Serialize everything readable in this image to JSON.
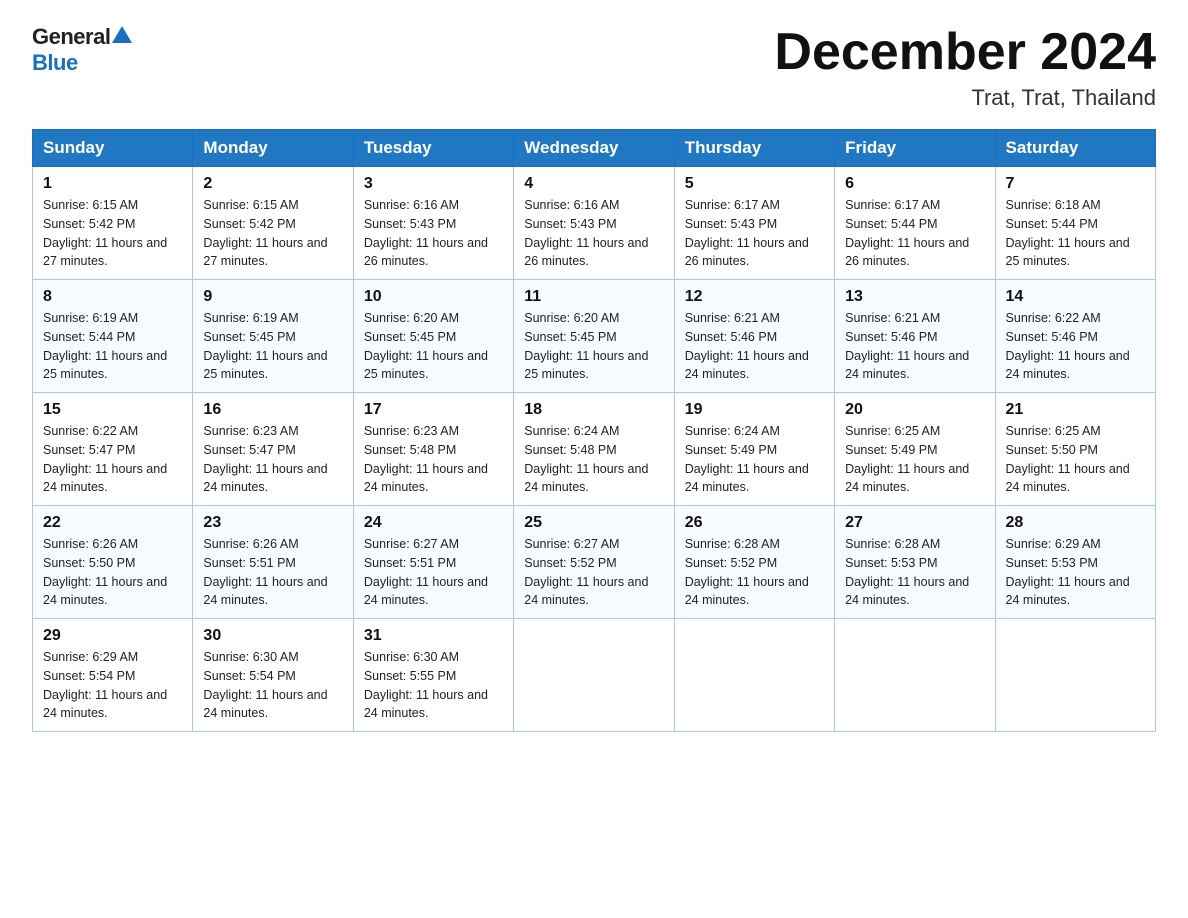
{
  "header": {
    "logo_general": "General",
    "logo_blue": "Blue",
    "month_title": "December 2024",
    "location": "Trat, Trat, Thailand"
  },
  "weekdays": [
    "Sunday",
    "Monday",
    "Tuesday",
    "Wednesday",
    "Thursday",
    "Friday",
    "Saturday"
  ],
  "weeks": [
    [
      {
        "day": "1",
        "sunrise": "Sunrise: 6:15 AM",
        "sunset": "Sunset: 5:42 PM",
        "daylight": "Daylight: 11 hours and 27 minutes."
      },
      {
        "day": "2",
        "sunrise": "Sunrise: 6:15 AM",
        "sunset": "Sunset: 5:42 PM",
        "daylight": "Daylight: 11 hours and 27 minutes."
      },
      {
        "day": "3",
        "sunrise": "Sunrise: 6:16 AM",
        "sunset": "Sunset: 5:43 PM",
        "daylight": "Daylight: 11 hours and 26 minutes."
      },
      {
        "day": "4",
        "sunrise": "Sunrise: 6:16 AM",
        "sunset": "Sunset: 5:43 PM",
        "daylight": "Daylight: 11 hours and 26 minutes."
      },
      {
        "day": "5",
        "sunrise": "Sunrise: 6:17 AM",
        "sunset": "Sunset: 5:43 PM",
        "daylight": "Daylight: 11 hours and 26 minutes."
      },
      {
        "day": "6",
        "sunrise": "Sunrise: 6:17 AM",
        "sunset": "Sunset: 5:44 PM",
        "daylight": "Daylight: 11 hours and 26 minutes."
      },
      {
        "day": "7",
        "sunrise": "Sunrise: 6:18 AM",
        "sunset": "Sunset: 5:44 PM",
        "daylight": "Daylight: 11 hours and 25 minutes."
      }
    ],
    [
      {
        "day": "8",
        "sunrise": "Sunrise: 6:19 AM",
        "sunset": "Sunset: 5:44 PM",
        "daylight": "Daylight: 11 hours and 25 minutes."
      },
      {
        "day": "9",
        "sunrise": "Sunrise: 6:19 AM",
        "sunset": "Sunset: 5:45 PM",
        "daylight": "Daylight: 11 hours and 25 minutes."
      },
      {
        "day": "10",
        "sunrise": "Sunrise: 6:20 AM",
        "sunset": "Sunset: 5:45 PM",
        "daylight": "Daylight: 11 hours and 25 minutes."
      },
      {
        "day": "11",
        "sunrise": "Sunrise: 6:20 AM",
        "sunset": "Sunset: 5:45 PM",
        "daylight": "Daylight: 11 hours and 25 minutes."
      },
      {
        "day": "12",
        "sunrise": "Sunrise: 6:21 AM",
        "sunset": "Sunset: 5:46 PM",
        "daylight": "Daylight: 11 hours and 24 minutes."
      },
      {
        "day": "13",
        "sunrise": "Sunrise: 6:21 AM",
        "sunset": "Sunset: 5:46 PM",
        "daylight": "Daylight: 11 hours and 24 minutes."
      },
      {
        "day": "14",
        "sunrise": "Sunrise: 6:22 AM",
        "sunset": "Sunset: 5:46 PM",
        "daylight": "Daylight: 11 hours and 24 minutes."
      }
    ],
    [
      {
        "day": "15",
        "sunrise": "Sunrise: 6:22 AM",
        "sunset": "Sunset: 5:47 PM",
        "daylight": "Daylight: 11 hours and 24 minutes."
      },
      {
        "day": "16",
        "sunrise": "Sunrise: 6:23 AM",
        "sunset": "Sunset: 5:47 PM",
        "daylight": "Daylight: 11 hours and 24 minutes."
      },
      {
        "day": "17",
        "sunrise": "Sunrise: 6:23 AM",
        "sunset": "Sunset: 5:48 PM",
        "daylight": "Daylight: 11 hours and 24 minutes."
      },
      {
        "day": "18",
        "sunrise": "Sunrise: 6:24 AM",
        "sunset": "Sunset: 5:48 PM",
        "daylight": "Daylight: 11 hours and 24 minutes."
      },
      {
        "day": "19",
        "sunrise": "Sunrise: 6:24 AM",
        "sunset": "Sunset: 5:49 PM",
        "daylight": "Daylight: 11 hours and 24 minutes."
      },
      {
        "day": "20",
        "sunrise": "Sunrise: 6:25 AM",
        "sunset": "Sunset: 5:49 PM",
        "daylight": "Daylight: 11 hours and 24 minutes."
      },
      {
        "day": "21",
        "sunrise": "Sunrise: 6:25 AM",
        "sunset": "Sunset: 5:50 PM",
        "daylight": "Daylight: 11 hours and 24 minutes."
      }
    ],
    [
      {
        "day": "22",
        "sunrise": "Sunrise: 6:26 AM",
        "sunset": "Sunset: 5:50 PM",
        "daylight": "Daylight: 11 hours and 24 minutes."
      },
      {
        "day": "23",
        "sunrise": "Sunrise: 6:26 AM",
        "sunset": "Sunset: 5:51 PM",
        "daylight": "Daylight: 11 hours and 24 minutes."
      },
      {
        "day": "24",
        "sunrise": "Sunrise: 6:27 AM",
        "sunset": "Sunset: 5:51 PM",
        "daylight": "Daylight: 11 hours and 24 minutes."
      },
      {
        "day": "25",
        "sunrise": "Sunrise: 6:27 AM",
        "sunset": "Sunset: 5:52 PM",
        "daylight": "Daylight: 11 hours and 24 minutes."
      },
      {
        "day": "26",
        "sunrise": "Sunrise: 6:28 AM",
        "sunset": "Sunset: 5:52 PM",
        "daylight": "Daylight: 11 hours and 24 minutes."
      },
      {
        "day": "27",
        "sunrise": "Sunrise: 6:28 AM",
        "sunset": "Sunset: 5:53 PM",
        "daylight": "Daylight: 11 hours and 24 minutes."
      },
      {
        "day": "28",
        "sunrise": "Sunrise: 6:29 AM",
        "sunset": "Sunset: 5:53 PM",
        "daylight": "Daylight: 11 hours and 24 minutes."
      }
    ],
    [
      {
        "day": "29",
        "sunrise": "Sunrise: 6:29 AM",
        "sunset": "Sunset: 5:54 PM",
        "daylight": "Daylight: 11 hours and 24 minutes."
      },
      {
        "day": "30",
        "sunrise": "Sunrise: 6:30 AM",
        "sunset": "Sunset: 5:54 PM",
        "daylight": "Daylight: 11 hours and 24 minutes."
      },
      {
        "day": "31",
        "sunrise": "Sunrise: 6:30 AM",
        "sunset": "Sunset: 5:55 PM",
        "daylight": "Daylight: 11 hours and 24 minutes."
      },
      null,
      null,
      null,
      null
    ]
  ]
}
